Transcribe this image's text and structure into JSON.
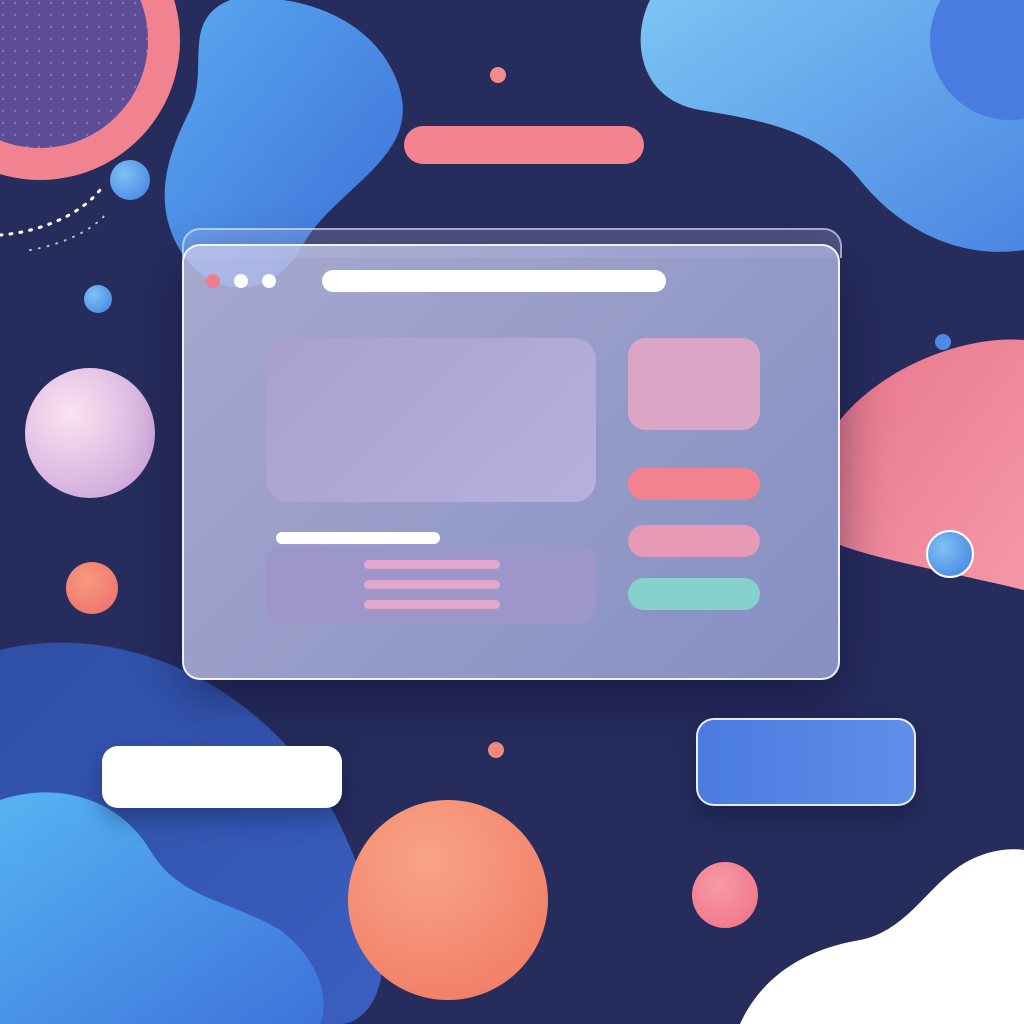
{
  "illustration": {
    "subject": "abstract-ui-window-composition",
    "colors": {
      "background": "#262c5c",
      "accent_pink": "#f3848e",
      "accent_blue": "#4a7be0",
      "accent_teal": "#86d1cb",
      "accent_coral": "#f6866c",
      "panel_lavender": "#b7b0dc",
      "white": "#ffffff"
    },
    "window_controls": [
      "close-dot",
      "minimize-dot",
      "maximize-dot"
    ],
    "side_buttons": [
      "pink-button",
      "light-pink-button",
      "teal-button"
    ]
  }
}
